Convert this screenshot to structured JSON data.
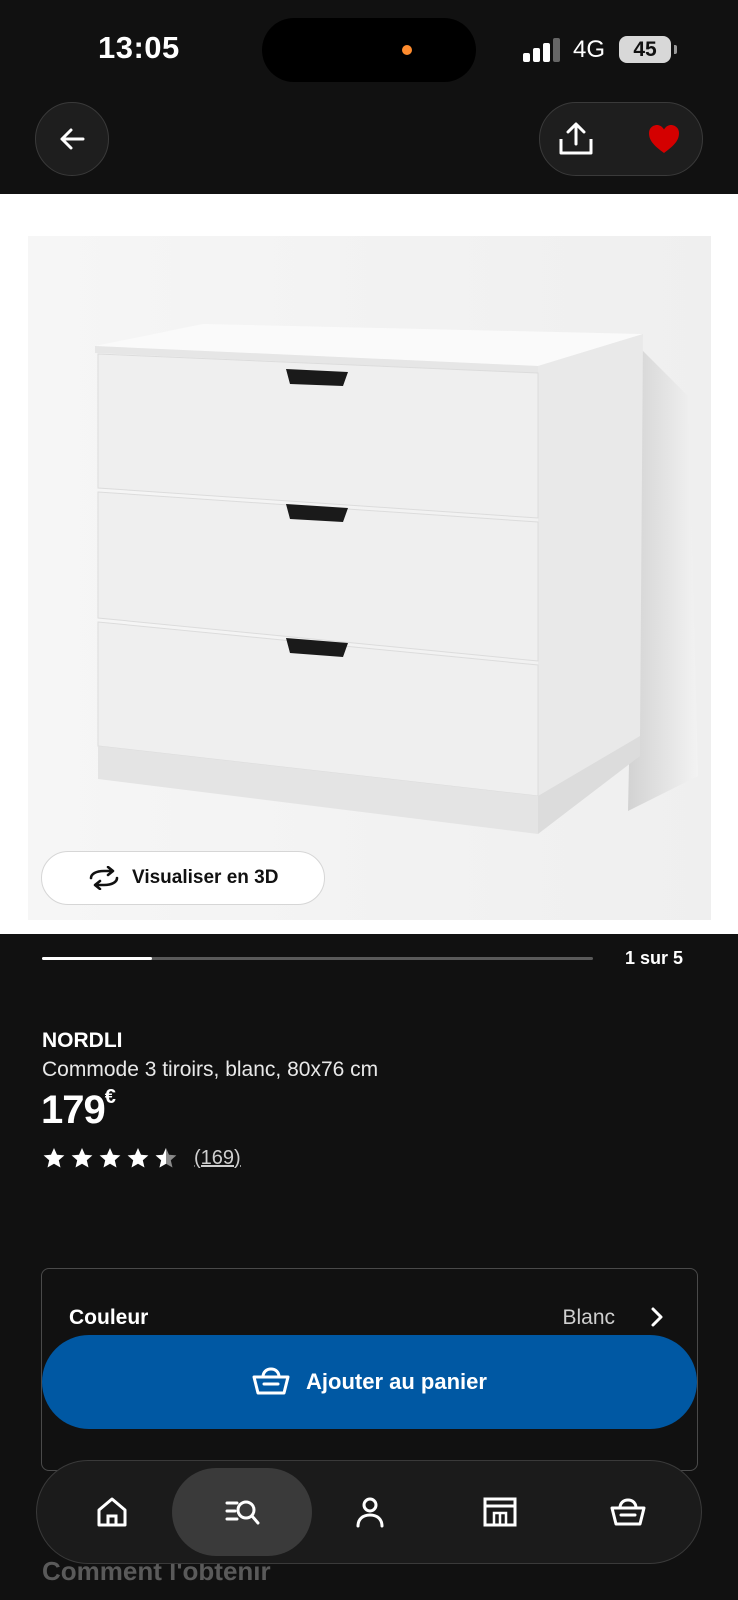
{
  "status_bar": {
    "time": "13:05",
    "network": "4G",
    "battery": "45"
  },
  "header": {
    "back_icon": "arrow-left-icon",
    "share_icon": "share-icon",
    "favorite_icon": "heart-filled-icon",
    "favorite_color": "#d40000"
  },
  "gallery": {
    "view_3d_label": "Visualiser en 3D",
    "page_indicator": "1 sur 5",
    "progress": 0.2
  },
  "product": {
    "brand": "NORDLI",
    "description": "Commode 3 tiroirs, blanc, 80x76 cm",
    "price": "179",
    "currency": "€",
    "rating": 4.5,
    "reviews": "(169)"
  },
  "color_selector": {
    "label": "Couleur",
    "value": "Blanc"
  },
  "add_to_cart": {
    "label": "Ajouter au panier",
    "color": "#0058a3"
  },
  "section_below": {
    "title": "Comment l'obtenir"
  },
  "bottom_nav": {
    "items": [
      {
        "icon": "home-icon",
        "active": false
      },
      {
        "icon": "search-list-icon",
        "active": true
      },
      {
        "icon": "profile-icon",
        "active": false
      },
      {
        "icon": "store-icon",
        "active": false
      },
      {
        "icon": "cart-icon",
        "active": false
      }
    ]
  }
}
